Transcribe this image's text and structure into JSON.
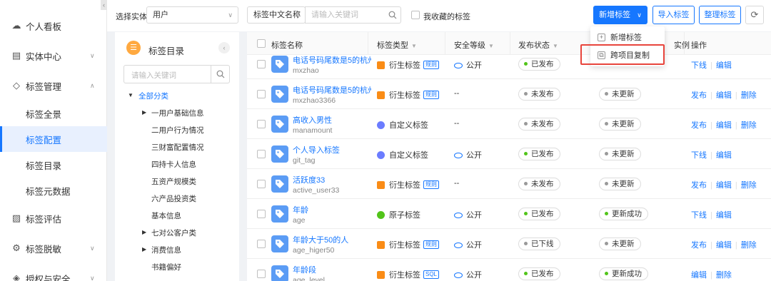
{
  "sidebar": {
    "collapse_icon": "‹",
    "items": [
      {
        "label": "个人看板",
        "icon": "dashboard-icon"
      },
      {
        "label": "实体中心",
        "icon": "entity-icon"
      },
      {
        "label": "标签管理",
        "icon": "tag-icon"
      },
      {
        "label": "标签评估",
        "icon": "evaluate-icon"
      },
      {
        "label": "标签脱敏",
        "icon": "desensitize-icon"
      },
      {
        "label": "授权与安全",
        "icon": "security-icon"
      }
    ],
    "sub_items": [
      {
        "label": "标签全景"
      },
      {
        "label": "标签配置"
      },
      {
        "label": "标签目录"
      },
      {
        "label": "标签元数据"
      }
    ]
  },
  "filter": {
    "entity_label": "选择实体",
    "entity_value": "用户",
    "field_value": "标签中文名称",
    "keyword_placeholder": "请输入关键词",
    "favorite_label": "我收藏的标签",
    "add_label": "新增标签",
    "import_label": "导入标签",
    "organize_label": "整理标签"
  },
  "add_menu": {
    "items": [
      {
        "label": "新增标签"
      },
      {
        "label": "跨项目复制"
      }
    ]
  },
  "directory": {
    "title": "标签目录",
    "badge": "☰",
    "search_placeholder": "请输入关键词",
    "root": "全部分类",
    "nodes": [
      {
        "label": "一用户基础信息",
        "expandable": true
      },
      {
        "label": "二用户行为情况",
        "expandable": false
      },
      {
        "label": "三财富配置情况",
        "expandable": false
      },
      {
        "label": "四持卡人信息",
        "expandable": false
      },
      {
        "label": "五资产规模类",
        "expandable": false
      },
      {
        "label": "六产品投资类",
        "expandable": false
      },
      {
        "label": "基本信息",
        "expandable": false
      },
      {
        "label": "七对公客户类",
        "expandable": true
      },
      {
        "label": "消费信息",
        "expandable": true
      },
      {
        "label": "书籍偏好",
        "expandable": false
      }
    ]
  },
  "table": {
    "headers": {
      "name": "标签名称",
      "type": "标签类型",
      "security": "安全等级",
      "publish": "发布状态",
      "instance": "实例",
      "ops": "操作"
    },
    "rows": [
      {
        "name": "电话号码尾数是5的杭州...",
        "code": "mxzhao",
        "type": "衍生标签",
        "type_icon": "o",
        "badge": "规则",
        "security": "公开",
        "has_eye": true,
        "publish": "已发布",
        "publish_color": "#52c41a",
        "update": "",
        "update_color": "",
        "ops": [
          "下线",
          "编辑"
        ]
      },
      {
        "name": "电话号码尾数是5的杭州...",
        "code": "mxzhao3366",
        "type": "衍生标签",
        "type_icon": "o",
        "badge": "规则",
        "security": "--",
        "has_eye": false,
        "publish": "未发布",
        "publish_color": "#999999",
        "update": "未更新",
        "update_color": "#999999",
        "ops": [
          "发布",
          "编辑",
          "删除"
        ]
      },
      {
        "name": "高收入男性",
        "code": "manamount",
        "type": "自定义标签",
        "type_icon": "c",
        "badge": "",
        "security": "--",
        "has_eye": false,
        "publish": "未发布",
        "publish_color": "#999999",
        "update": "未更新",
        "update_color": "#999999",
        "ops": [
          "发布",
          "编辑",
          "删除"
        ]
      },
      {
        "name": "个人导入标签",
        "code": "git_tag",
        "type": "自定义标签",
        "type_icon": "c",
        "badge": "",
        "security": "公开",
        "has_eye": true,
        "publish": "已发布",
        "publish_color": "#52c41a",
        "update": "未更新",
        "update_color": "#999999",
        "ops": [
          "下线",
          "编辑"
        ]
      },
      {
        "name": "活跃度33",
        "code": "active_user33",
        "type": "衍生标签",
        "type_icon": "o",
        "badge": "规则",
        "security": "--",
        "has_eye": false,
        "publish": "未发布",
        "publish_color": "#999999",
        "update": "未更新",
        "update_color": "#999999",
        "ops": [
          "发布",
          "编辑",
          "删除"
        ]
      },
      {
        "name": "年龄",
        "code": "age",
        "type": "原子标签",
        "type_icon": "g",
        "badge": "",
        "security": "公开",
        "has_eye": true,
        "publish": "已发布",
        "publish_color": "#52c41a",
        "update": "更新成功",
        "update_color": "#52c41a",
        "ops": [
          "下线",
          "编辑"
        ]
      },
      {
        "name": "年龄大于50的人",
        "code": "age_higer50",
        "type": "衍生标签",
        "type_icon": "o",
        "badge": "规则",
        "security": "公开",
        "has_eye": true,
        "publish": "已下线",
        "publish_color": "#999999",
        "update": "未更新",
        "update_color": "#999999",
        "ops": [
          "发布",
          "编辑",
          "删除"
        ]
      },
      {
        "name": "年龄段",
        "code": "age_level",
        "type": "衍生标签",
        "type_icon": "o",
        "badge": "SQL",
        "security": "公开",
        "has_eye": true,
        "publish": "已发布",
        "publish_color": "#52c41a",
        "update": "更新成功",
        "update_color": "#52c41a",
        "ops": [
          "编辑",
          "删除"
        ]
      }
    ]
  },
  "colors": {
    "primary": "#1677ff",
    "highlight": "#e8453c",
    "published": "#52c41a"
  }
}
